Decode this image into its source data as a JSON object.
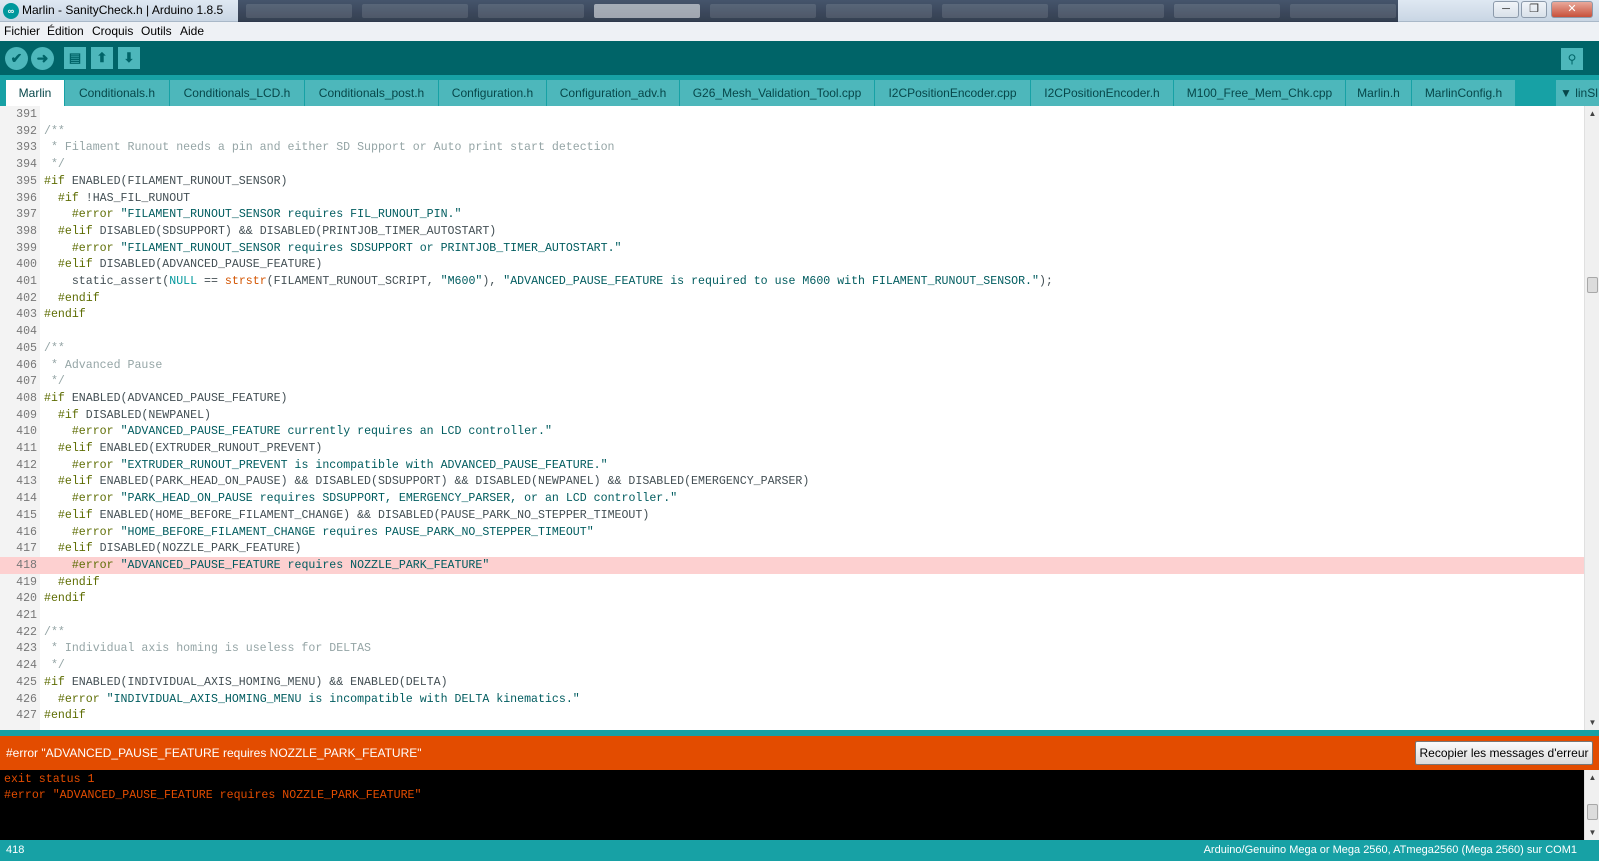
{
  "window": {
    "title": "Marlin - SanityCheck.h | Arduino 1.8.5",
    "app_icon": "arduino-logo-icon",
    "minimize": "─",
    "maximize": "❐",
    "close": "✕"
  },
  "menu": {
    "items": [
      "Fichier",
      "Édition",
      "Croquis",
      "Outils",
      "Aide"
    ]
  },
  "toolbar": {
    "verify_icon": "✔",
    "upload_icon": "➜",
    "new_icon": "▤",
    "open_icon": "⬆",
    "save_icon": "⬇",
    "serial_monitor_icon": "⚲"
  },
  "tabs": [
    {
      "label": "Marlin"
    },
    {
      "label": "Conditionals.h"
    },
    {
      "label": "Conditionals_LCD.h"
    },
    {
      "label": "Conditionals_post.h"
    },
    {
      "label": "Configuration.h"
    },
    {
      "label": "Configuration_adv.h"
    },
    {
      "label": "G26_Mesh_Validation_Tool.cpp"
    },
    {
      "label": "I2CPositionEncoder.cpp"
    },
    {
      "label": "I2CPositionEncoder.h"
    },
    {
      "label": "M100_Free_Mem_Chk.cpp"
    },
    {
      "label": "Marlin.h"
    },
    {
      "label": "MarlinConfig.h"
    }
  ],
  "tab_menu": {
    "label": "▼ linSl"
  },
  "code": {
    "highlighted_line": "418",
    "lines": [
      {
        "n": "391",
        "t": ""
      },
      {
        "n": "392",
        "t": "/**"
      },
      {
        "n": "393",
        "t": " * Filament Runout needs a pin and either SD Support or Auto print start detection"
      },
      {
        "n": "394",
        "t": " */"
      },
      {
        "n": "395",
        "t": "#if ENABLED(FILAMENT_RUNOUT_SENSOR)"
      },
      {
        "n": "396",
        "t": "  #if !HAS_FIL_RUNOUT"
      },
      {
        "n": "397",
        "t": "    #error \"FILAMENT_RUNOUT_SENSOR requires FIL_RUNOUT_PIN.\""
      },
      {
        "n": "398",
        "t": "  #elif DISABLED(SDSUPPORT) && DISABLED(PRINTJOB_TIMER_AUTOSTART)"
      },
      {
        "n": "399",
        "t": "    #error \"FILAMENT_RUNOUT_SENSOR requires SDSUPPORT or PRINTJOB_TIMER_AUTOSTART.\""
      },
      {
        "n": "400",
        "t": "  #elif DISABLED(ADVANCED_PAUSE_FEATURE)"
      },
      {
        "n": "401",
        "t": "    static_assert(NULL == strstr(FILAMENT_RUNOUT_SCRIPT, \"M600\"), \"ADVANCED_PAUSE_FEATURE is required to use M600 with FILAMENT_RUNOUT_SENSOR.\");"
      },
      {
        "n": "402",
        "t": "  #endif"
      },
      {
        "n": "403",
        "t": "#endif"
      },
      {
        "n": "404",
        "t": ""
      },
      {
        "n": "405",
        "t": "/**"
      },
      {
        "n": "406",
        "t": " * Advanced Pause"
      },
      {
        "n": "407",
        "t": " */"
      },
      {
        "n": "408",
        "t": "#if ENABLED(ADVANCED_PAUSE_FEATURE)"
      },
      {
        "n": "409",
        "t": "  #if DISABLED(NEWPANEL)"
      },
      {
        "n": "410",
        "t": "    #error \"ADVANCED_PAUSE_FEATURE currently requires an LCD controller.\""
      },
      {
        "n": "411",
        "t": "  #elif ENABLED(EXTRUDER_RUNOUT_PREVENT)"
      },
      {
        "n": "412",
        "t": "    #error \"EXTRUDER_RUNOUT_PREVENT is incompatible with ADVANCED_PAUSE_FEATURE.\""
      },
      {
        "n": "413",
        "t": "  #elif ENABLED(PARK_HEAD_ON_PAUSE) && DISABLED(SDSUPPORT) && DISABLED(NEWPANEL) && DISABLED(EMERGENCY_PARSER)"
      },
      {
        "n": "414",
        "t": "    #error \"PARK_HEAD_ON_PAUSE requires SDSUPPORT, EMERGENCY_PARSER, or an LCD controller.\""
      },
      {
        "n": "415",
        "t": "  #elif ENABLED(HOME_BEFORE_FILAMENT_CHANGE) && DISABLED(PAUSE_PARK_NO_STEPPER_TIMEOUT)"
      },
      {
        "n": "416",
        "t": "    #error \"HOME_BEFORE_FILAMENT_CHANGE requires PAUSE_PARK_NO_STEPPER_TIMEOUT\""
      },
      {
        "n": "417",
        "t": "  #elif DISABLED(NOZZLE_PARK_FEATURE)"
      },
      {
        "n": "418",
        "t": "    #error \"ADVANCED_PAUSE_FEATURE requires NOZZLE_PARK_FEATURE\""
      },
      {
        "n": "419",
        "t": "  #endif"
      },
      {
        "n": "420",
        "t": "#endif"
      },
      {
        "n": "421",
        "t": ""
      },
      {
        "n": "422",
        "t": "/**"
      },
      {
        "n": "423",
        "t": " * Individual axis homing is useless for DELTAS"
      },
      {
        "n": "424",
        "t": " */"
      },
      {
        "n": "425",
        "t": "#if ENABLED(INDIVIDUAL_AXIS_HOMING_MENU) && ENABLED(DELTA)"
      },
      {
        "n": "426",
        "t": "  #error \"INDIVIDUAL_AXIS_HOMING_MENU is incompatible with DELTA kinematics.\""
      },
      {
        "n": "427",
        "t": "#endif"
      }
    ]
  },
  "error_bar": {
    "message": "#error \"ADVANCED_PAUSE_FEATURE requires NOZZLE_PARK_FEATURE\"",
    "copy_button": "Recopier les messages d'erreur"
  },
  "console": {
    "lines": [
      "exit status 1",
      "#error \"ADVANCED_PAUSE_FEATURE requires NOZZLE_PARK_FEATURE\""
    ]
  },
  "status": {
    "line_number": "418",
    "board": "Arduino/Genuino Mega or Mega 2560, ATmega2560 (Mega 2560) sur COM1"
  },
  "scroll": {
    "editor_position": 0.27,
    "editor_arrow_up": "▲",
    "editor_arrow_down": "▼",
    "console_arrow_up": "▲",
    "console_arrow_down": "▼"
  },
  "colors": {
    "toolbar": "#006468",
    "tabbar": "#17a1a5",
    "tab": "#4db7bb",
    "error_bar": "#e34c00",
    "highlight_line": "#fdd0d0"
  }
}
